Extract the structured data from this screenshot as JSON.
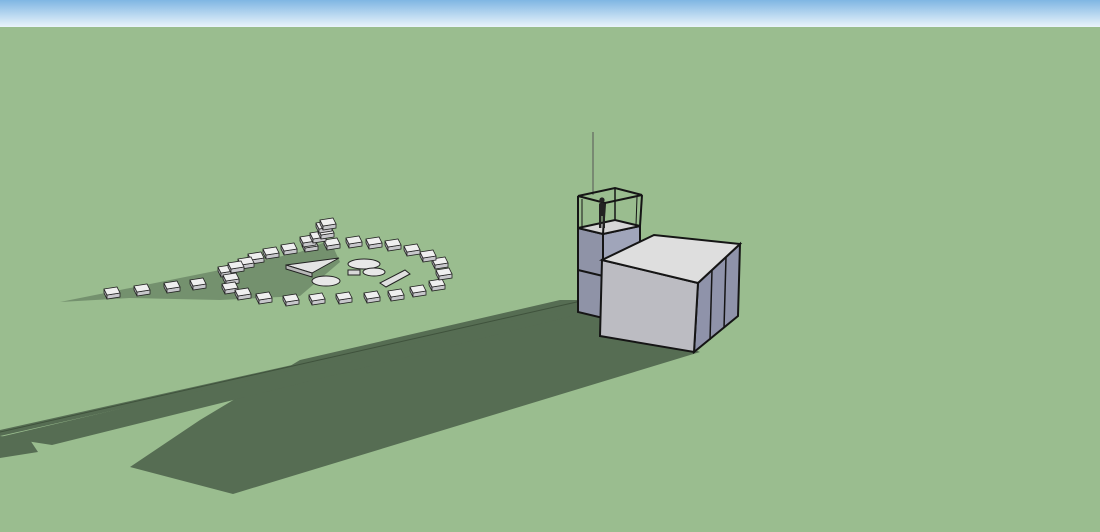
{
  "scene": {
    "kind": "3d-model-viewport",
    "colors": {
      "sky_top": "#7fb6e3",
      "sky_bottom": "#eaf4fb",
      "ground": "#9abd8f",
      "shadow": "#566d53",
      "block_top": "#f0f0f0",
      "block_side": "#b9b9bd",
      "glass": "#9aa0b7",
      "edge": "#1c1c1c"
    },
    "objects": [
      "ground-plane",
      "sky",
      "circular-block-arrangement",
      "glass-tower",
      "human-figure",
      "antenna",
      "rectangular-building",
      "cast-shadows"
    ]
  }
}
